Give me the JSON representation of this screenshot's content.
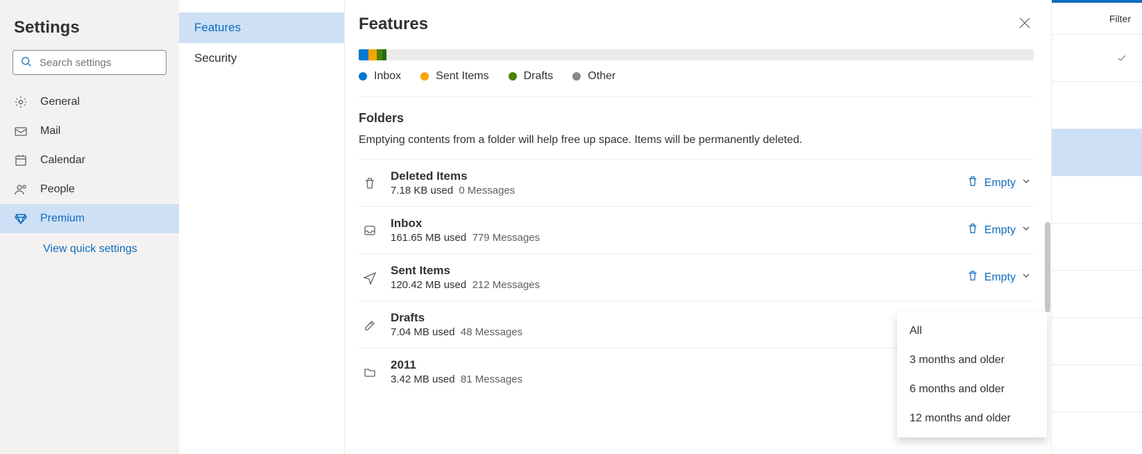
{
  "sidebar": {
    "title": "Settings",
    "search_placeholder": "Search settings",
    "items": [
      {
        "label": "General"
      },
      {
        "label": "Mail"
      },
      {
        "label": "Calendar"
      },
      {
        "label": "People"
      },
      {
        "label": "Premium"
      }
    ],
    "quick_link": "View quick settings"
  },
  "navcol": {
    "items": [
      {
        "label": "Features",
        "active": true
      },
      {
        "label": "Security",
        "active": false
      }
    ]
  },
  "main": {
    "title": "Features",
    "legend": [
      {
        "label": "Inbox",
        "color": "#0078d4"
      },
      {
        "label": "Sent Items",
        "color": "#f7a500"
      },
      {
        "label": "Drafts",
        "color": "#498205"
      },
      {
        "label": "Other",
        "color": "#8a8886"
      }
    ],
    "folders_section_title": "Folders",
    "folders_section_desc": "Emptying contents from a folder will help free up space. Items will be permanently deleted.",
    "empty_label": "Empty",
    "folders": [
      {
        "name": "Deleted Items",
        "size": "7.18 KB used",
        "msgs": "0 Messages",
        "icon": "trash",
        "empty": true
      },
      {
        "name": "Inbox",
        "size": "161.65 MB used",
        "msgs": "779 Messages",
        "icon": "inbox",
        "empty": true
      },
      {
        "name": "Sent Items",
        "size": "120.42 MB used",
        "msgs": "212 Messages",
        "icon": "send",
        "empty": true
      },
      {
        "name": "Drafts",
        "size": "7.04 MB used",
        "msgs": "48 Messages",
        "icon": "draft",
        "empty": false
      },
      {
        "name": "2011",
        "size": "3.42 MB used",
        "msgs": "81 Messages",
        "icon": "folder",
        "empty": false
      }
    ]
  },
  "dropdown": {
    "items": [
      "All",
      "3 months and older",
      "6 months and older",
      "12 months and older"
    ]
  },
  "bg": {
    "filter_label": "Filter"
  }
}
